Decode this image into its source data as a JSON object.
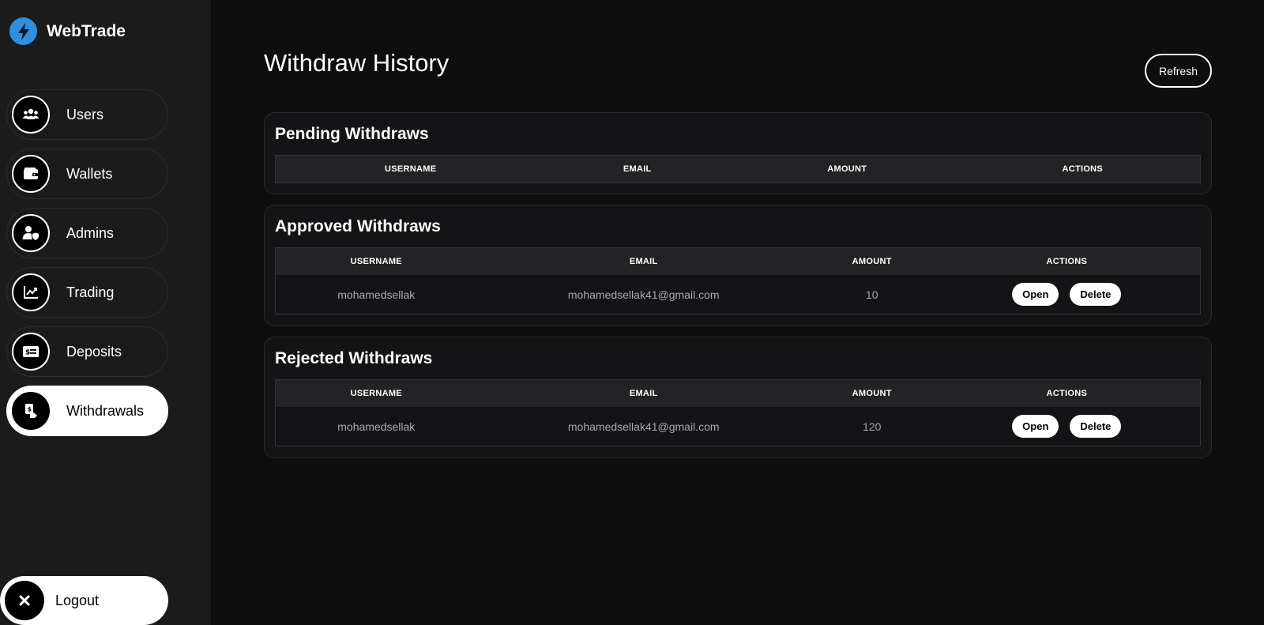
{
  "brand": {
    "name": "WebTrade",
    "logo_icon": "lightning-bolt-icon",
    "logo_color": "#2f8fdd"
  },
  "sidebar": {
    "items": [
      {
        "label": "Users",
        "icon": "users-group-icon",
        "active": false
      },
      {
        "label": "Wallets",
        "icon": "wallet-icon",
        "active": false
      },
      {
        "label": "Admins",
        "icon": "admin-shield-user-icon",
        "active": false
      },
      {
        "label": "Trading",
        "icon": "line-chart-icon",
        "active": false
      },
      {
        "label": "Deposits",
        "icon": "money-card-icon",
        "active": false
      },
      {
        "label": "Withdrawals",
        "icon": "withdraw-hand-icon",
        "active": true
      }
    ],
    "logout": {
      "label": "Logout",
      "icon": "close-x-icon"
    }
  },
  "header": {
    "title": "Withdraw History",
    "refresh_label": "Refresh"
  },
  "sections": {
    "pending": {
      "title": "Pending Withdraws",
      "columns": [
        "USERNAME",
        "EMAIL",
        "AMOUNT",
        "ACTIONS"
      ],
      "rows": []
    },
    "approved": {
      "title": "Approved Withdraws",
      "columns": [
        "USERNAME",
        "EMAIL",
        "AMOUNT",
        "ACTIONS"
      ],
      "rows": [
        {
          "username": "mohamedsellak",
          "email": "mohamedsellak41@gmail.com",
          "amount": "10",
          "open_label": "Open",
          "delete_label": "Delete"
        }
      ]
    },
    "rejected": {
      "title": "Rejected Withdraws",
      "columns": [
        "USERNAME",
        "EMAIL",
        "AMOUNT",
        "ACTIONS"
      ],
      "rows": [
        {
          "username": "mohamedsellak",
          "email": "mohamedsellak41@gmail.com",
          "amount": "120",
          "open_label": "Open",
          "delete_label": "Delete"
        }
      ]
    }
  },
  "colors": {
    "background": "#0e0e0f",
    "sidebar": "#1b1b1c",
    "panel": "#141416",
    "accent": "#ffffff"
  }
}
